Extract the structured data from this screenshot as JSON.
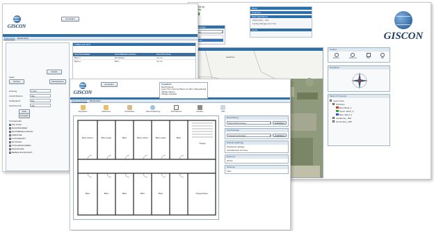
{
  "brand": {
    "name": "GISCON"
  },
  "right_screen": {
    "logged_in_line1": "Logged in as",
    "logged_in_line2": "k.Guenter",
    "nav_headers": [
      "About",
      "Overview",
      "Web Applications",
      "Home"
    ],
    "app_lines": [
      "WebFacility - GIS",
      "Facility Management Tool"
    ],
    "map_label": "Map",
    "selection_header": "Map Selection",
    "selection_value": "Ebenen",
    "selection_options": [
      "Ebenen",
      "Gebäude"
    ],
    "toolbox_title": "Toolbox",
    "toolbox_tools": [
      "Zoom in",
      "Zoom out",
      "Pan",
      "Info"
    ],
    "navigation_title": "Navigation",
    "toc_title": "Table Of Contents",
    "toc_items": [
      {
        "label": "Layer Karte",
        "indent": 0,
        "checked": true
      },
      {
        "label": "Orthofoto",
        "indent": 1,
        "checked": true
      },
      {
        "label": "Red: Band_1",
        "indent": 2,
        "swatch": "#d03030"
      },
      {
        "label": "Green: Band_2",
        "indent": 2,
        "swatch": "#30a030"
      },
      {
        "label": "Blue: Band_3",
        "indent": 2,
        "swatch": "#3050c8"
      },
      {
        "label": "Landkreise_ BW",
        "indent": 1,
        "checked": true
      },
      {
        "label": "Gemeinden_ BW",
        "indent": 1,
        "checked": true
      }
    ],
    "place_label": "Haarthau",
    "scale_text": "Der erste an 0000000 angemeldet"
  },
  "left_screen": {
    "login_button": "Anmelden",
    "tabs": [
      "Dokumente",
      "Tabellenliste"
    ],
    "detail_button": "Details",
    "filter_label": "Stelle",
    "search_button": "Suchen",
    "reset_button": "Zurücksetzen",
    "field_labels": [
      "Nutzung",
      "Anzahl Räume",
      "Gebäudeteil",
      "Geschoss-Nr."
    ],
    "field_values": [
      "1,024",
      "Alle",
      "EG",
      "Alle"
    ],
    "filter_button": "Filter",
    "show_button": "Anzeigen",
    "table_header": "TABELLEN-INFO",
    "table_rows": [
      {
        "c1": "RAUMNUMMER",
        "c2": "RAUMBEZEICHNUNG",
        "c3": "RAUMFLÄCHE"
      },
      {
        "c1": "Büro 1",
        "c2": "Einzelbüro",
        "c3": "4,1 m²"
      },
      {
        "c1": "Büro 2",
        "c2": "Büro",
        "c3": "4,1 m²"
      }
    ],
    "checklist_title": "Suchauswahl",
    "checklist_items": [
      "Alle Felder",
      "RAUMNUMMER",
      "RAUMBEZEICHNUNG",
      "GEBÄUDE",
      "FLÄCHENART",
      "NUTZUNG",
      "FLÄCHENNUMMER",
      "RAUMCODE",
      "BERECHNUNGSART"
    ]
  },
  "front_screen": {
    "login_button": "Anmelden",
    "tabs": [
      "Dokumentenliste",
      "Tabellenliste"
    ],
    "tools": [
      "Vergrößern",
      "Verkleinern",
      "Verschieben",
      "Volle Ausdehnung",
      "Informationen",
      "Drucken",
      "Hilfe"
    ],
    "popup_title": "Projektinfo",
    "popup_lines": [
      "Beschreibung:",
      "Layer 'OG 1' wird auf Basis von Plan / Raumdarstellung",
      "Abfrage Räume",
      "Abfrage Gebäude"
    ],
    "room_labels": [
      "Büro Lehrer",
      "Büro Leiter",
      "Büro",
      "Treppe",
      "Büro Lehrer",
      "Büro Leiter",
      "Büro",
      "Büro",
      "Büro",
      "Büro",
      "Büro",
      "Büro",
      "Treppenhaus"
    ],
    "panel_sections": [
      "Beschriftung",
      "Symbolologie",
      "Definitionsabfrage",
      "Referenz",
      "Optionen"
    ],
    "panel_select1": "Überschrift Anzeigen",
    "panel_select2": "Original-Symbologie",
    "apply_button": "Ausführen",
    "panel_texts": [
      "Definitionen-Abfrage",
      "Schwellenwert der Karte",
      "Einheit",
      "Stufe"
    ]
  }
}
